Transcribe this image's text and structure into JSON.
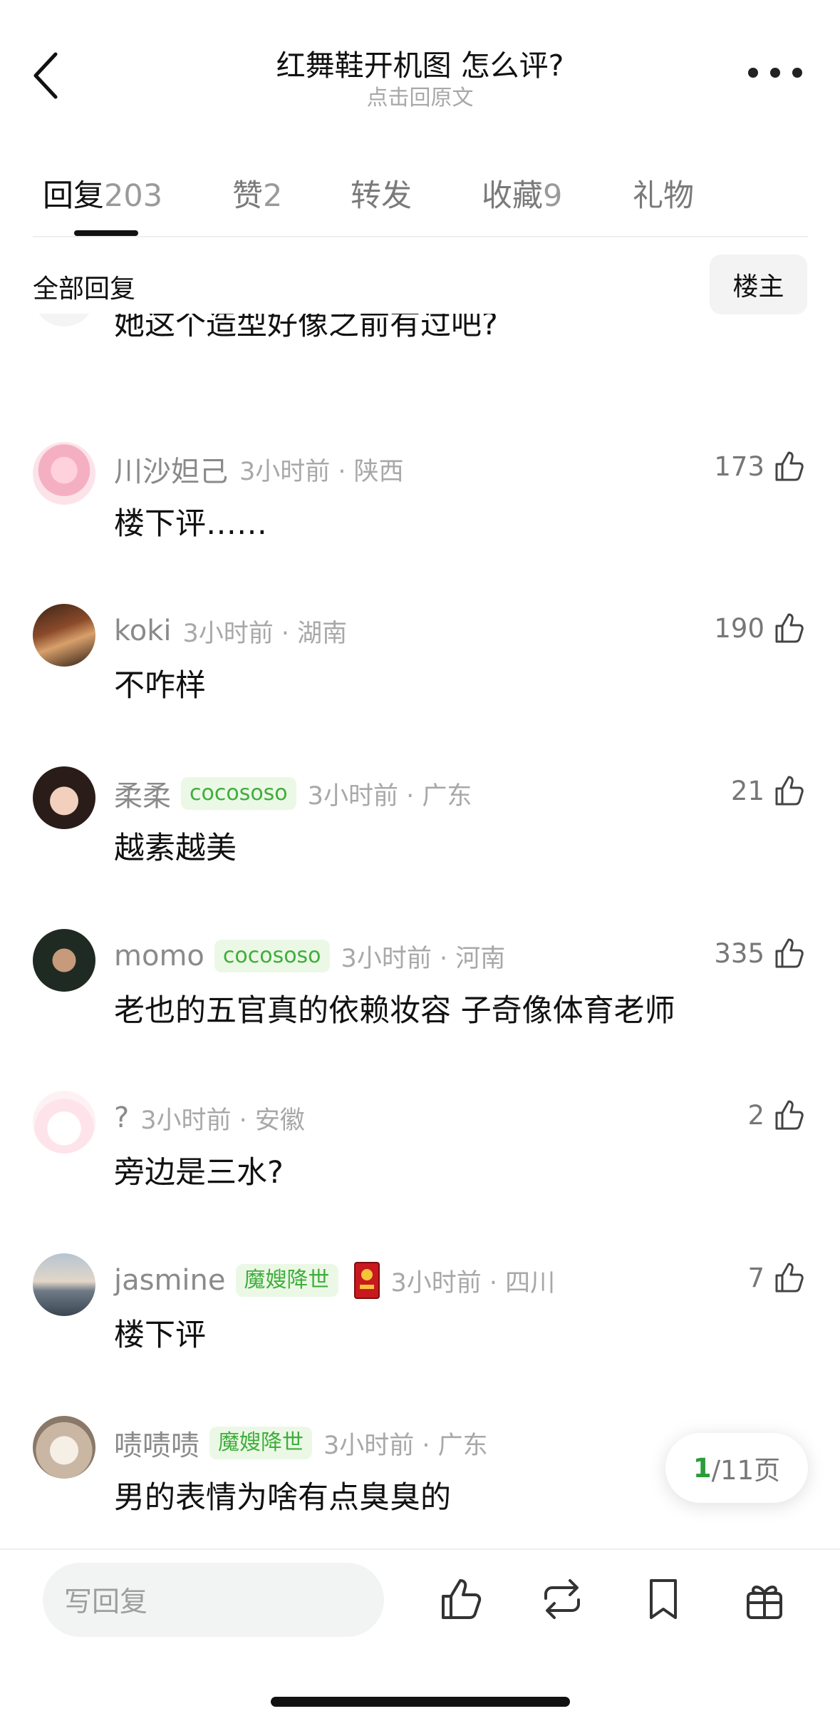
{
  "header": {
    "title": "红舞鞋开机图 怎么评?",
    "subtitle": "点击回原文"
  },
  "tabs": [
    {
      "label": "回复",
      "count": "203",
      "active": true
    },
    {
      "label": "赞",
      "count": "2",
      "active": false
    },
    {
      "label": "转发",
      "count": "",
      "active": false
    },
    {
      "label": "收藏",
      "count": "9",
      "active": false
    },
    {
      "label": "礼物",
      "count": "",
      "active": false
    }
  ],
  "filter": {
    "all_replies": "全部回复",
    "owner_only": "楼主"
  },
  "first_comment_text": "她这个造型好像之前有过吧?",
  "comments": [
    {
      "username": "川沙妲己",
      "badge": "",
      "time_location": "3小时前 · 陕西",
      "likes": "173",
      "text": "楼下评……"
    },
    {
      "username": "koki",
      "badge": "",
      "time_location": "3小时前 · 湖南",
      "likes": "190",
      "text": "不咋样"
    },
    {
      "username": "柔柔",
      "badge": "cocososo",
      "time_location": "3小时前 · 广东",
      "likes": "21",
      "text": "越素越美"
    },
    {
      "username": "momo",
      "badge": "cocososo",
      "time_location": "3小时前 · 河南",
      "likes": "335",
      "text": "老也的五官真的依赖妆容 子奇像体育老师"
    },
    {
      "username": "?",
      "badge": "",
      "time_location": "3小时前 · 安徽",
      "likes": "2",
      "text": "旁边是三水?"
    },
    {
      "username": "jasmine",
      "badge": "魔嫂降世",
      "time_location": "3小时前 · 四川",
      "likes": "7",
      "text": "楼下评"
    },
    {
      "username": "啧啧啧",
      "badge": "魔嫂降世",
      "time_location": "3小时前 · 广东",
      "likes": "",
      "text": "男的表情为啥有点臭臭的"
    }
  ],
  "pagination": {
    "current": "1",
    "total_suffix": "/11页"
  },
  "bottom_bar": {
    "reply_placeholder": "写回复"
  },
  "colors": {
    "badge_bg": "#ecf8e6",
    "badge_text": "#3fae3c",
    "page_current": "#2a9d3a"
  },
  "icons": [
    "back-arrow-icon",
    "more-dots-icon",
    "thumbs-up-icon",
    "repost-icon",
    "bookmark-icon",
    "gift-icon"
  ]
}
